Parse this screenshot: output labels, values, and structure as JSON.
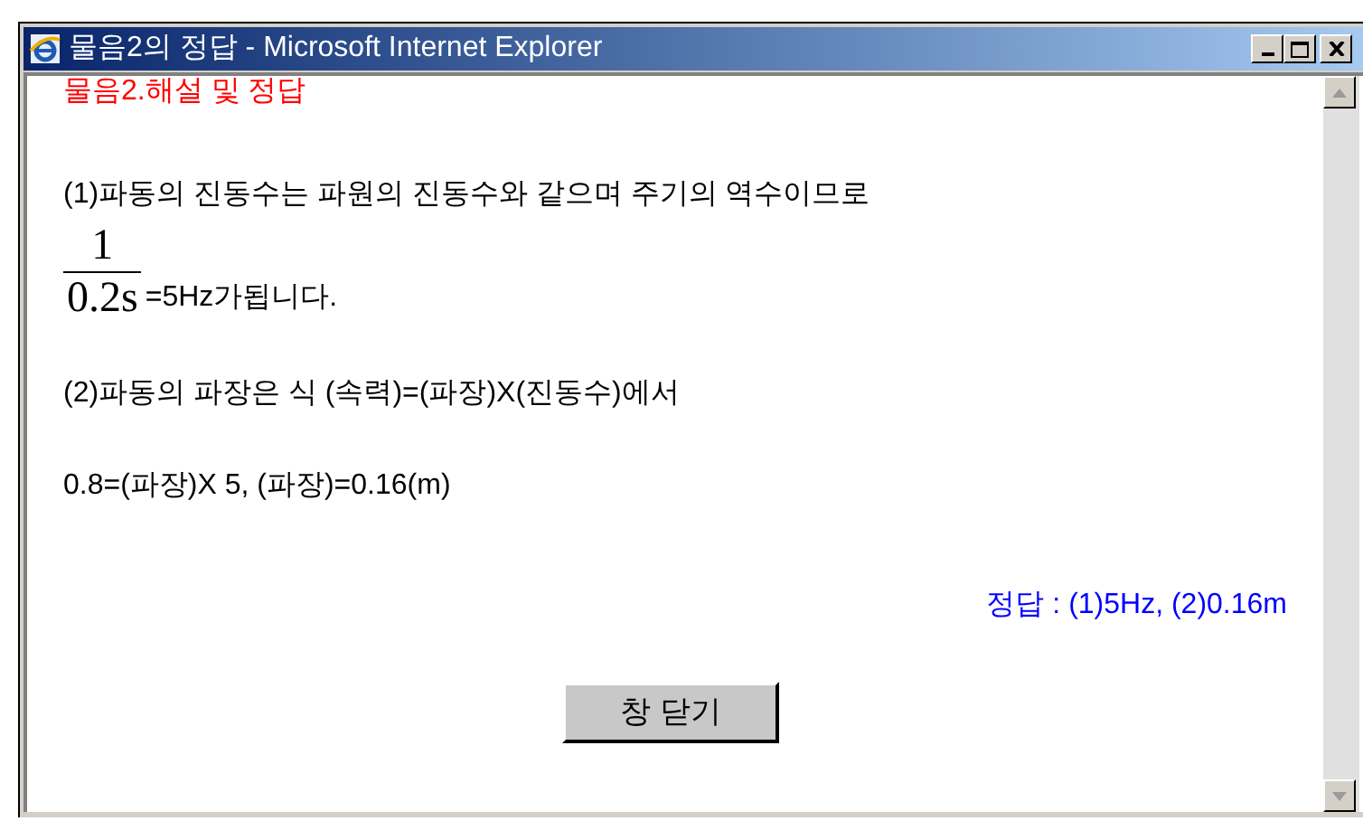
{
  "window": {
    "title": "물음2의 정답 - Microsoft Internet Explorer"
  },
  "heading": "물음2.해설 및 정답",
  "lines": [
    {
      "kind": "text",
      "text": "(1)파동의 진동수는 파원의 진동수와 같으며 주기의 역수이므로"
    },
    {
      "kind": "fraction",
      "numerator": "1",
      "denominator": "0.2s",
      "text": "=5Hz가됩니다."
    },
    {
      "kind": "text",
      "text": "(2)파동의 파장은 식 (속력)=(파장)X(진동수)에서"
    },
    {
      "kind": "text",
      "text": "0.8=(파장)X 5, (파장)=0.16(m)"
    }
  ],
  "answer": "정답 : (1)5Hz,  (2)0.16m",
  "close_button": "창 닫기"
}
